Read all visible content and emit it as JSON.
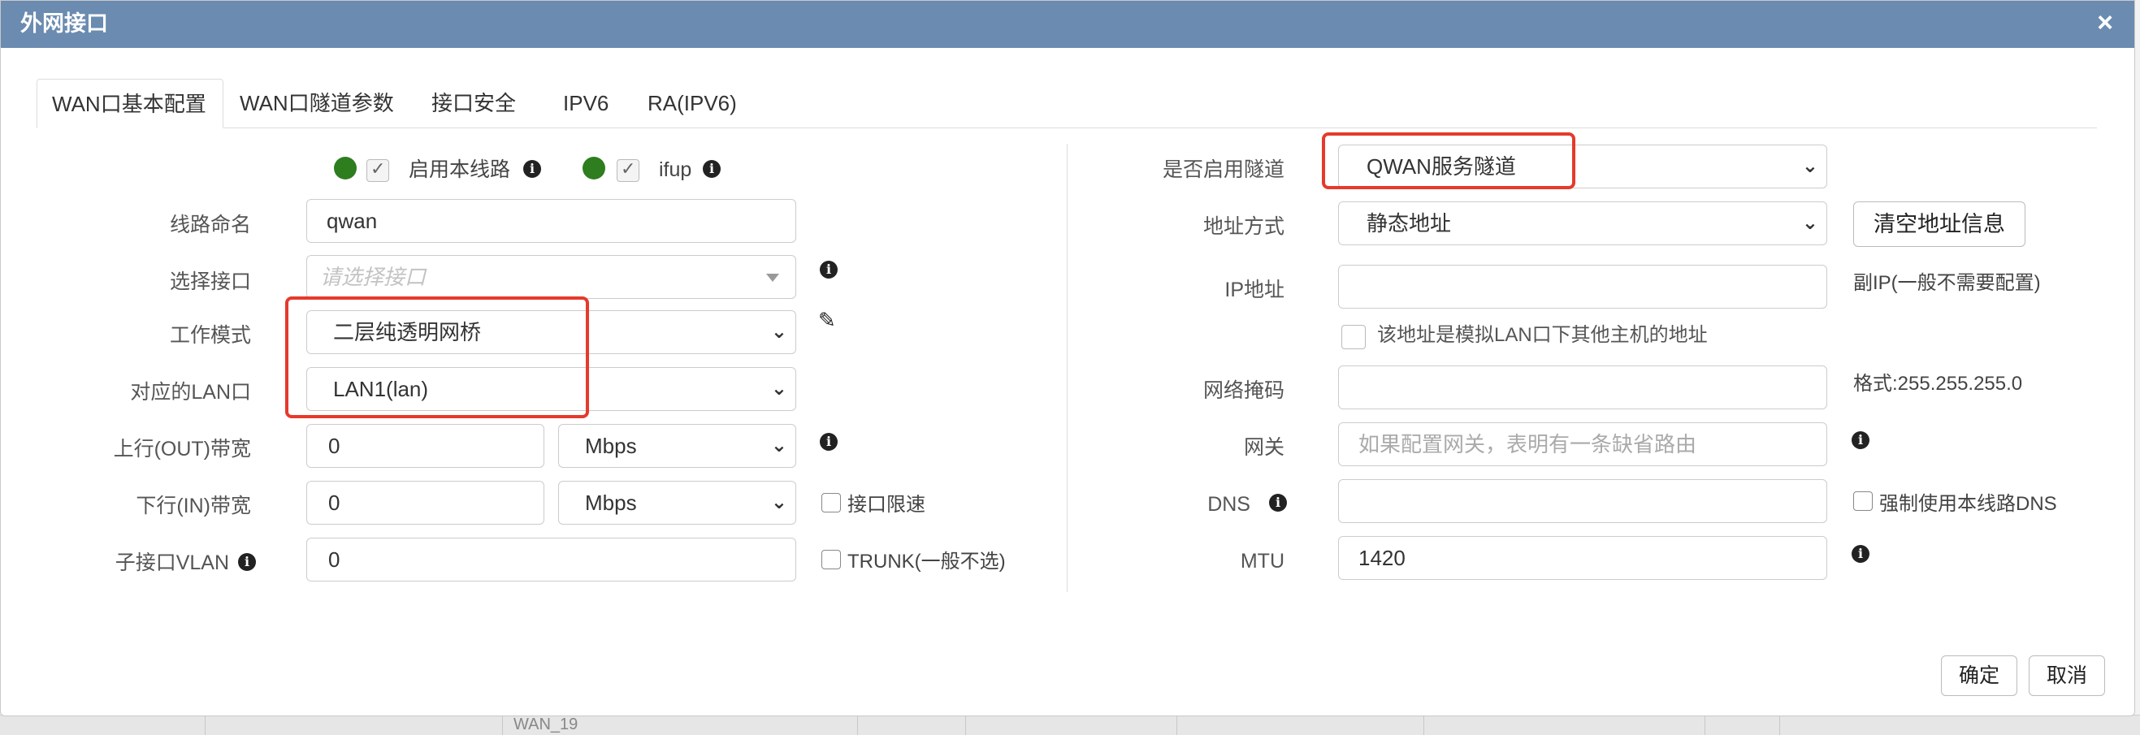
{
  "dialog": {
    "title": "外网接口",
    "close_symbol": "×"
  },
  "tabs": [
    "WAN口基本配置",
    "WAN口隧道参数",
    "接口安全",
    "IPV6",
    "RA(IPV6)"
  ],
  "left": {
    "enable_line_label": "启用本线路",
    "ifup_label": "ifup",
    "line_name_label": "线路命名",
    "line_name_value": "qwan",
    "select_iface_label": "选择接口",
    "select_iface_placeholder": "请选择接口",
    "work_mode_label": "工作模式",
    "work_mode_value": "二层纯透明网桥",
    "lan_label": "对应的LAN口",
    "lan_value": "LAN1(lan)",
    "up_bw_label": "上行(OUT)带宽",
    "up_bw_value": "0",
    "up_bw_unit": "Mbps",
    "down_bw_label": "下行(IN)带宽",
    "down_bw_value": "0",
    "down_bw_unit": "Mbps",
    "iface_limit_label": "接口限速",
    "vlan_label": "子接口VLAN",
    "vlan_value": "0",
    "trunk_label": "TRUNK(一般不选)"
  },
  "right": {
    "tunnel_label": "是否启用隧道",
    "tunnel_value": "QWAN服务隧道",
    "addr_mode_label": "地址方式",
    "addr_mode_value": "静态地址",
    "clear_addr_button": "清空地址信息",
    "ip_label": "IP地址",
    "ip_value": "",
    "ip_hint": "副IP(一般不需要配置)",
    "simulate_lan_label": "该地址是模拟LAN口下其他主机的地址",
    "mask_label": "网络掩码",
    "mask_value": "",
    "mask_hint": "格式:255.255.255.0",
    "gateway_label": "网关",
    "gateway_placeholder": "如果配置网关，表明有一条缺省路由",
    "dns_label": "DNS",
    "dns_value": "",
    "force_dns_label": "强制使用本线路DNS",
    "mtu_label": "MTU",
    "mtu_value": "1420"
  },
  "footer": {
    "ok_button": "确定",
    "cancel_button": "取消"
  },
  "background": {
    "row_text": "WAN_19"
  },
  "icons": {
    "info": "info-circle-icon",
    "edit": "pencil-icon",
    "status": "status-dot-icon"
  },
  "colors": {
    "titlebar": "#6b8bb0",
    "status_green": "#2e7d1f",
    "highlight": "#e53a2c"
  }
}
